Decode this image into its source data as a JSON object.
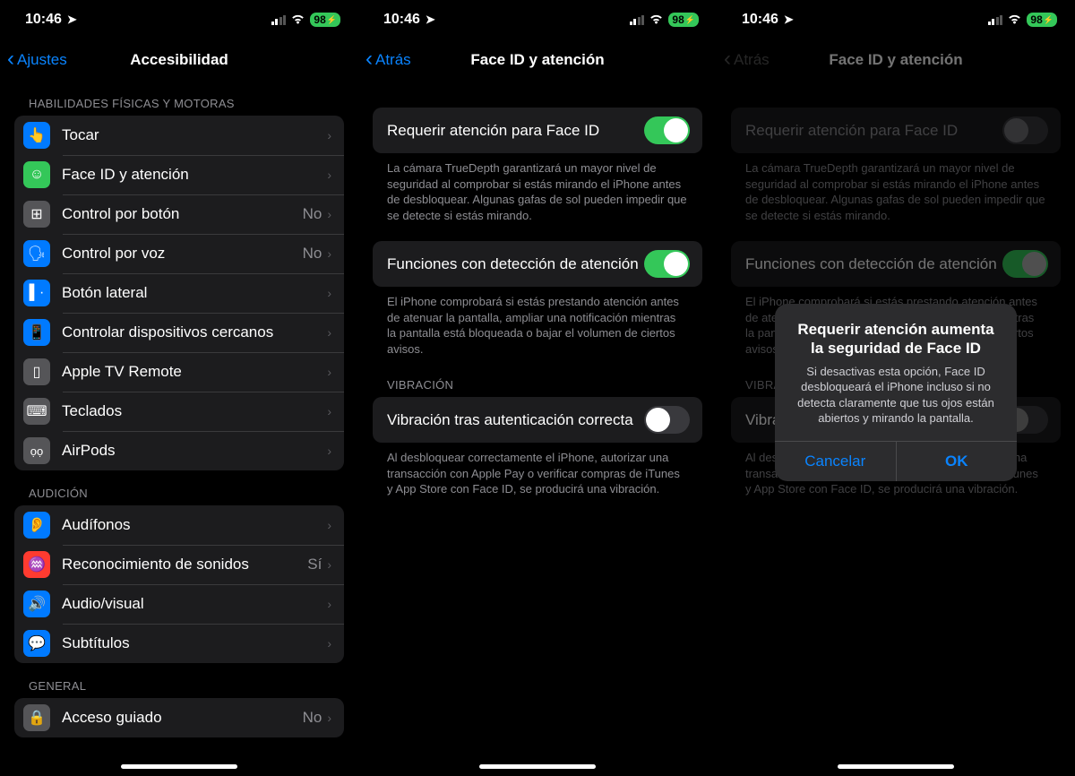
{
  "status": {
    "time": "10:46",
    "battery": "98"
  },
  "screen1": {
    "back": "Ajustes",
    "title": "Accesibilidad",
    "sec_physical": "HABILIDADES FÍSICAS Y MOTORAS",
    "rows_physical": [
      {
        "label": "Tocar"
      },
      {
        "label": "Face ID y atención"
      },
      {
        "label": "Control por botón",
        "value": "No"
      },
      {
        "label": "Control por voz",
        "value": "No"
      },
      {
        "label": "Botón lateral"
      },
      {
        "label": "Controlar dispositivos cercanos"
      },
      {
        "label": "Apple TV Remote"
      },
      {
        "label": "Teclados"
      },
      {
        "label": "AirPods"
      }
    ],
    "sec_hearing": "AUDICIÓN",
    "rows_hearing": [
      {
        "label": "Audífonos"
      },
      {
        "label": "Reconocimiento de sonidos",
        "value": "Sí"
      },
      {
        "label": "Audio/visual"
      },
      {
        "label": "Subtítulos"
      }
    ],
    "sec_general": "GENERAL",
    "rows_general": [
      {
        "label": "Acceso guiado",
        "value": "No"
      }
    ]
  },
  "screen2": {
    "back": "Atrás",
    "title": "Face ID y atención",
    "toggle1": {
      "label": "Requerir atención para Face ID",
      "on": true
    },
    "footer1": "La cámara TrueDepth garantizará un mayor nivel de seguridad al comprobar si estás mirando el iPhone antes de desbloquear. Algunas gafas de sol pueden impedir que se detecte si estás mirando.",
    "toggle2": {
      "label": "Funciones con detección de atención",
      "on": true
    },
    "footer2": "El iPhone comprobará si estás prestando atención antes de atenuar la pantalla, ampliar una notificación mientras la pantalla está bloqueada o bajar el volumen de ciertos avisos.",
    "sec_vib": "VIBRACIÓN",
    "toggle3": {
      "label": "Vibración tras autenticación correcta",
      "on": false
    },
    "footer3": "Al desbloquear correctamente el iPhone, autorizar una transacción con Apple Pay o verificar compras de iTunes y App Store con Face ID, se producirá una vibración."
  },
  "screen3": {
    "back": "Atrás",
    "title": "Face ID y atención",
    "toggle1": {
      "label": "Requerir atención para Face ID",
      "on": false
    },
    "footer1": "La cámara TrueDepth garantizará un mayor nivel de seguridad al comprobar si estás mirando el iPhone antes de desbloquear. Algunas gafas de sol pueden impedir que se detecte si estás mirando.",
    "toggle2": {
      "label": "Funciones con detección de atención",
      "on": true
    },
    "footer2_short": "El iPh\nantes\nmient\nvolun",
    "sec_vib": "VIBR",
    "toggle3": {
      "label": "Vibr\naute",
      "on": false
    },
    "footer3": "Al desbloquear correctamente el iPhone, autorizar una transacción con Apple Pay o verificar compras de iTunes y App Store con Face ID, se producirá una vibración.",
    "alert": {
      "title": "Requerir atención aumenta la seguridad de Face ID",
      "message": "Si desactivas esta opción, Face ID desbloqueará el iPhone incluso si no detecta claramente que tus ojos están abiertos y mirando la pantalla.",
      "cancel": "Cancelar",
      "ok": "OK"
    }
  }
}
